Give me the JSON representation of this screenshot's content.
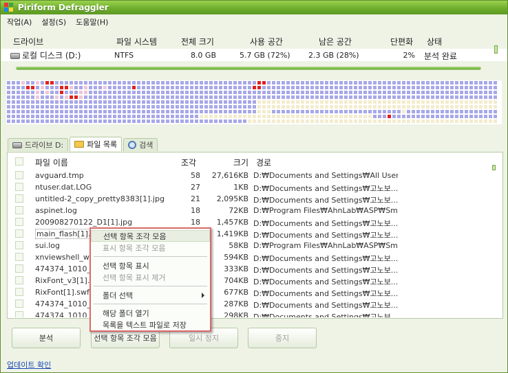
{
  "window": {
    "title": "Piriform Defraggler"
  },
  "menu": [
    "작업(A)",
    "설정(S)",
    "도움말(H)"
  ],
  "drives": {
    "headers": [
      "드라이브",
      "파일 시스템",
      "전체 크기",
      "사용 공간",
      "남은 공간",
      "단편화",
      "상태"
    ],
    "row": {
      "name": "로컬 디스크 (D:)",
      "fs": "NTFS",
      "total": "8.0 GB",
      "used": "5.7 GB (72%)",
      "free": "2.3 GB (28%)",
      "frag": "2%",
      "status": "분석 완료"
    },
    "progress_fraction": 1.0
  },
  "tabs": [
    "드라이브 D:",
    "파일 목록",
    "검색"
  ],
  "file_list": {
    "headers": [
      "파일 이름",
      "조각",
      "크기",
      "경로"
    ],
    "rows": [
      {
        "name": "avguard.tmp",
        "frag": "58",
        "size": "27,616KB",
        "path": "D:₩Documents and Settings₩All User..."
      },
      {
        "name": "ntuser.dat.LOG",
        "frag": "27",
        "size": "1KB",
        "path": "D:₩Documents and Settings₩고노보..."
      },
      {
        "name": "untitled-2_copy_pretty8383[1].jpg",
        "frag": "21",
        "size": "2,095KB",
        "path": "D:₩Documents and Settings₩고노보..."
      },
      {
        "name": "aspinet.log",
        "frag": "18",
        "size": "72KB",
        "path": "D:₩Program Files₩AhnLab₩ASP₩Sm..."
      },
      {
        "name": "200908270122_D1[1].jpg",
        "frag": "18",
        "size": "1,457KB",
        "path": "D:₩Documents and Settings₩고노보..."
      },
      {
        "name": "main_flash[1].swf",
        "frag": "",
        "size": "1,419KB",
        "path": "D:₩Documents and Settings₩고노보..."
      },
      {
        "name": "sui.log",
        "frag": "",
        "size": "58KB",
        "path": "D:₩Program Files₩AhnLab₩ASP₩Sm..."
      },
      {
        "name": "xnviewshell_wal",
        "frag": "",
        "size": "594KB",
        "path": "D:₩Documents and Settings₩고노보..."
      },
      {
        "name": "474374_1010_4",
        "frag": "",
        "size": "333KB",
        "path": "D:₩Documents and Settings₩고노보..."
      },
      {
        "name": "RixFont_v3[1].s",
        "frag": "",
        "size": "704KB",
        "path": "D:₩Documents and Settings₩고노보..."
      },
      {
        "name": "RixFont[1].swf",
        "frag": "",
        "size": "677KB",
        "path": "D:₩Documents and Settings₩고노보..."
      },
      {
        "name": "474374_1010_3",
        "frag": "",
        "size": "287KB",
        "path": "D:₩Documents and Settings₩고노보..."
      },
      {
        "name": "474374_1010_2",
        "frag": "",
        "size": "298KB",
        "path": "D:₩Documents and Settings₩고노보..."
      }
    ]
  },
  "context_menu": {
    "items": [
      {
        "label": "선택 항목 조각 모음",
        "state": "highlight"
      },
      {
        "label": "표시 항목 조각 모음",
        "state": "disabled"
      },
      {
        "label": "선택 항목 표시",
        "state": "normal"
      },
      {
        "label": "선택 항목 표시 제거",
        "state": "disabled"
      },
      {
        "label": "폴더 선택",
        "state": "normal"
      },
      {
        "label": "해당 폴더 열기",
        "state": "normal"
      },
      {
        "label": "목록을 텍스트 파일로 저장",
        "state": "normal"
      }
    ]
  },
  "buttons": {
    "analyze": "분석",
    "defrag_selected": "선택 항목 조각 모음",
    "pause": "일시 정지",
    "stop": "중지"
  },
  "footer": {
    "update_link": "업데이트 확인"
  },
  "colors": {
    "accent": "#6fae2c",
    "block_used": "#a7a7e8",
    "block_free": "#f3eccd",
    "block_fragmented": "#e02020",
    "block_pink": "#f0c6d8",
    "menu_border": "#d96a6a"
  }
}
